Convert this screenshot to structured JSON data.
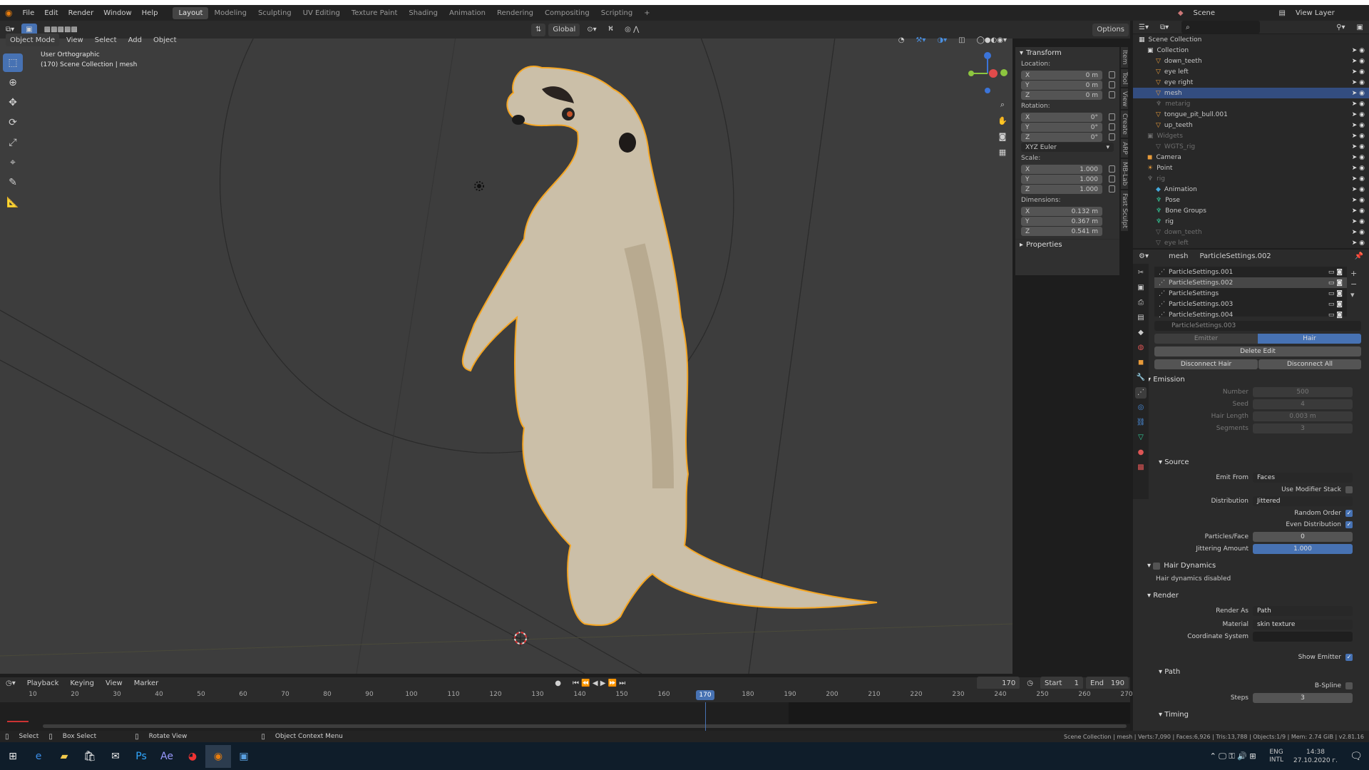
{
  "menubar": {
    "items": [
      "File",
      "Edit",
      "Render",
      "Window",
      "Help"
    ],
    "workspaces": [
      "Layout",
      "Modeling",
      "Sculpting",
      "UV Editing",
      "Texture Paint",
      "Shading",
      "Animation",
      "Rendering",
      "Compositing",
      "Scripting"
    ],
    "active_workspace": "Layout",
    "scene_label": "Scene",
    "view_layer_label": "View Layer"
  },
  "viewport_header": {
    "mode": "Object Mode",
    "menus": [
      "View",
      "Select",
      "Add",
      "Object"
    ],
    "orientation": "Global",
    "options": "Options"
  },
  "viewport": {
    "view_name": "User Orthographic",
    "context": "(170) Scene Collection | mesh"
  },
  "n_tabs": [
    "Item",
    "Tool",
    "View",
    "Create",
    "ARP",
    "MB-Lab",
    "Fast Sculpt"
  ],
  "npanel": {
    "transform_title": "Transform",
    "location_label": "Location:",
    "location": [
      {
        "axis": "X",
        "value": "0 m"
      },
      {
        "axis": "Y",
        "value": "0 m"
      },
      {
        "axis": "Z",
        "value": "0 m"
      }
    ],
    "rotation_label": "Rotation:",
    "rotation": [
      {
        "axis": "X",
        "value": "0°"
      },
      {
        "axis": "Y",
        "value": "0°"
      },
      {
        "axis": "Z",
        "value": "0°"
      }
    ],
    "rotation_mode": "XYZ Euler",
    "scale_label": "Scale:",
    "scale": [
      {
        "axis": "X",
        "value": "1.000"
      },
      {
        "axis": "Y",
        "value": "1.000"
      },
      {
        "axis": "Z",
        "value": "1.000"
      }
    ],
    "dimensions_label": "Dimensions:",
    "dimensions": [
      {
        "axis": "X",
        "value": "0.132 m"
      },
      {
        "axis": "Y",
        "value": "0.367 m"
      },
      {
        "axis": "Z",
        "value": "0.541 m"
      }
    ],
    "properties_title": "Properties"
  },
  "outliner": {
    "rows": [
      {
        "name": "Scene Collection",
        "indent": 0,
        "dim": false,
        "sel": false,
        "icon": "▦",
        "color": "#ddd"
      },
      {
        "name": "Collection",
        "indent": 1,
        "dim": false,
        "sel": false,
        "icon": "▣",
        "color": "#ddd"
      },
      {
        "name": "down_teeth",
        "indent": 2,
        "dim": false,
        "sel": false,
        "icon": "▽",
        "color": "#e89b3a"
      },
      {
        "name": "eye left",
        "indent": 2,
        "dim": false,
        "sel": false,
        "icon": "▽",
        "color": "#e89b3a"
      },
      {
        "name": "eye right",
        "indent": 2,
        "dim": false,
        "sel": false,
        "icon": "▽",
        "color": "#e89b3a"
      },
      {
        "name": "mesh",
        "indent": 2,
        "dim": false,
        "sel": true,
        "icon": "▽",
        "color": "#e89b3a"
      },
      {
        "name": "metarig",
        "indent": 2,
        "dim": true,
        "sel": false,
        "icon": "♆",
        "color": "#6f6f6f"
      },
      {
        "name": "tongue_pit_bull.001",
        "indent": 2,
        "dim": false,
        "sel": false,
        "icon": "▽",
        "color": "#e89b3a"
      },
      {
        "name": "up_teeth",
        "indent": 2,
        "dim": false,
        "sel": false,
        "icon": "▽",
        "color": "#e89b3a"
      },
      {
        "name": "Widgets",
        "indent": 1,
        "dim": true,
        "sel": false,
        "icon": "▣",
        "color": "#6f6f6f"
      },
      {
        "name": "WGTS_rig",
        "indent": 2,
        "dim": true,
        "sel": false,
        "icon": "▽",
        "color": "#6f6f6f"
      },
      {
        "name": "Camera",
        "indent": 1,
        "dim": false,
        "sel": false,
        "icon": "◼",
        "color": "#e89b3a"
      },
      {
        "name": "Point",
        "indent": 1,
        "dim": false,
        "sel": false,
        "icon": "☀",
        "color": "#e89b3a"
      },
      {
        "name": "rig",
        "indent": 1,
        "dim": true,
        "sel": false,
        "icon": "♆",
        "color": "#6f6f6f"
      },
      {
        "name": "Animation",
        "indent": 2,
        "dim": false,
        "sel": false,
        "icon": "◆",
        "color": "#4ad"
      },
      {
        "name": "Pose",
        "indent": 2,
        "dim": false,
        "sel": false,
        "icon": "♆",
        "color": "#3c9"
      },
      {
        "name": "Bone Groups",
        "indent": 2,
        "dim": false,
        "sel": false,
        "icon": "♆",
        "color": "#3c9"
      },
      {
        "name": "rig",
        "indent": 2,
        "dim": false,
        "sel": false,
        "icon": "♆",
        "color": "#3c9"
      },
      {
        "name": "down_teeth",
        "indent": 2,
        "dim": true,
        "sel": false,
        "icon": "▽",
        "color": "#6f6f6f"
      },
      {
        "name": "eye left",
        "indent": 2,
        "dim": true,
        "sel": false,
        "icon": "▽",
        "color": "#6f6f6f"
      }
    ]
  },
  "properties": {
    "object_name": "mesh",
    "particle_settings_active": "ParticleSettings.002",
    "particle_list": [
      "ParticleSettings.001",
      "ParticleSettings.002",
      "ParticleSettings",
      "ParticleSettings.003",
      "ParticleSettings.004"
    ],
    "settings_field": "ParticleSettings.003",
    "type_emitter": "Emitter",
    "type_hair": "Hair",
    "delete_edit": "Delete Edit",
    "disconnect_hair": "Disconnect Hair",
    "disconnect_all": "Disconnect All",
    "emission_title": "Emission",
    "number_label": "Number",
    "number": "500",
    "seed_label": "Seed",
    "seed": "4",
    "hair_length_label": "Hair Length",
    "hair_length": "0.003 m",
    "segments_label": "Segments",
    "segments": "3",
    "source_title": "Source",
    "emit_from_label": "Emit From",
    "emit_from": "Faces",
    "use_modifier_stack": "Use Modifier Stack",
    "distribution_label": "Distribution",
    "distribution": "Jittered",
    "random_order": "Random Order",
    "even_distribution": "Even Distribution",
    "particles_face_label": "Particles/Face",
    "particles_face": "0",
    "jittering_label": "Jittering Amount",
    "jittering": "1.000",
    "hair_dynamics_title": "Hair Dynamics",
    "hair_dynamics_disabled": "Hair dynamics disabled",
    "render_title": "Render",
    "render_as_label": "Render As",
    "render_as": "Path",
    "material_label": "Material",
    "material": "skin texture",
    "coord_system_label": "Coordinate System",
    "show_emitter": "Show Emitter",
    "path_title": "Path",
    "bspline": "B-Spline",
    "steps_label": "Steps",
    "steps": "3",
    "timing_title": "Timing"
  },
  "timeline": {
    "menus": [
      "Playback",
      "Keying",
      "View",
      "Marker"
    ],
    "current_frame": "170",
    "start_label": "Start",
    "start": "1",
    "end_label": "End",
    "end": "190",
    "ticks": [
      "10",
      "20",
      "30",
      "40",
      "50",
      "60",
      "70",
      "80",
      "90",
      "100",
      "110",
      "120",
      "130",
      "140",
      "150",
      "160",
      "170",
      "180",
      "190",
      "200",
      "210",
      "220",
      "230",
      "240",
      "250",
      "260",
      "270"
    ],
    "playhead": "170"
  },
  "statusbar": {
    "select": "Select",
    "box_select": "Box Select",
    "rotate_view": "Rotate View",
    "context_menu": "Object Context Menu",
    "stats": "Scene Collection | mesh | Verts:7,090 | Faces:6,926 | Tris:13,788 | Objects:1/9 | Mem: 2.74 GiB | v2.81.16"
  },
  "taskbar": {
    "lang1": "ENG",
    "lang2": "INTL",
    "time": "14:38",
    "date": "27.10.2020 г."
  }
}
